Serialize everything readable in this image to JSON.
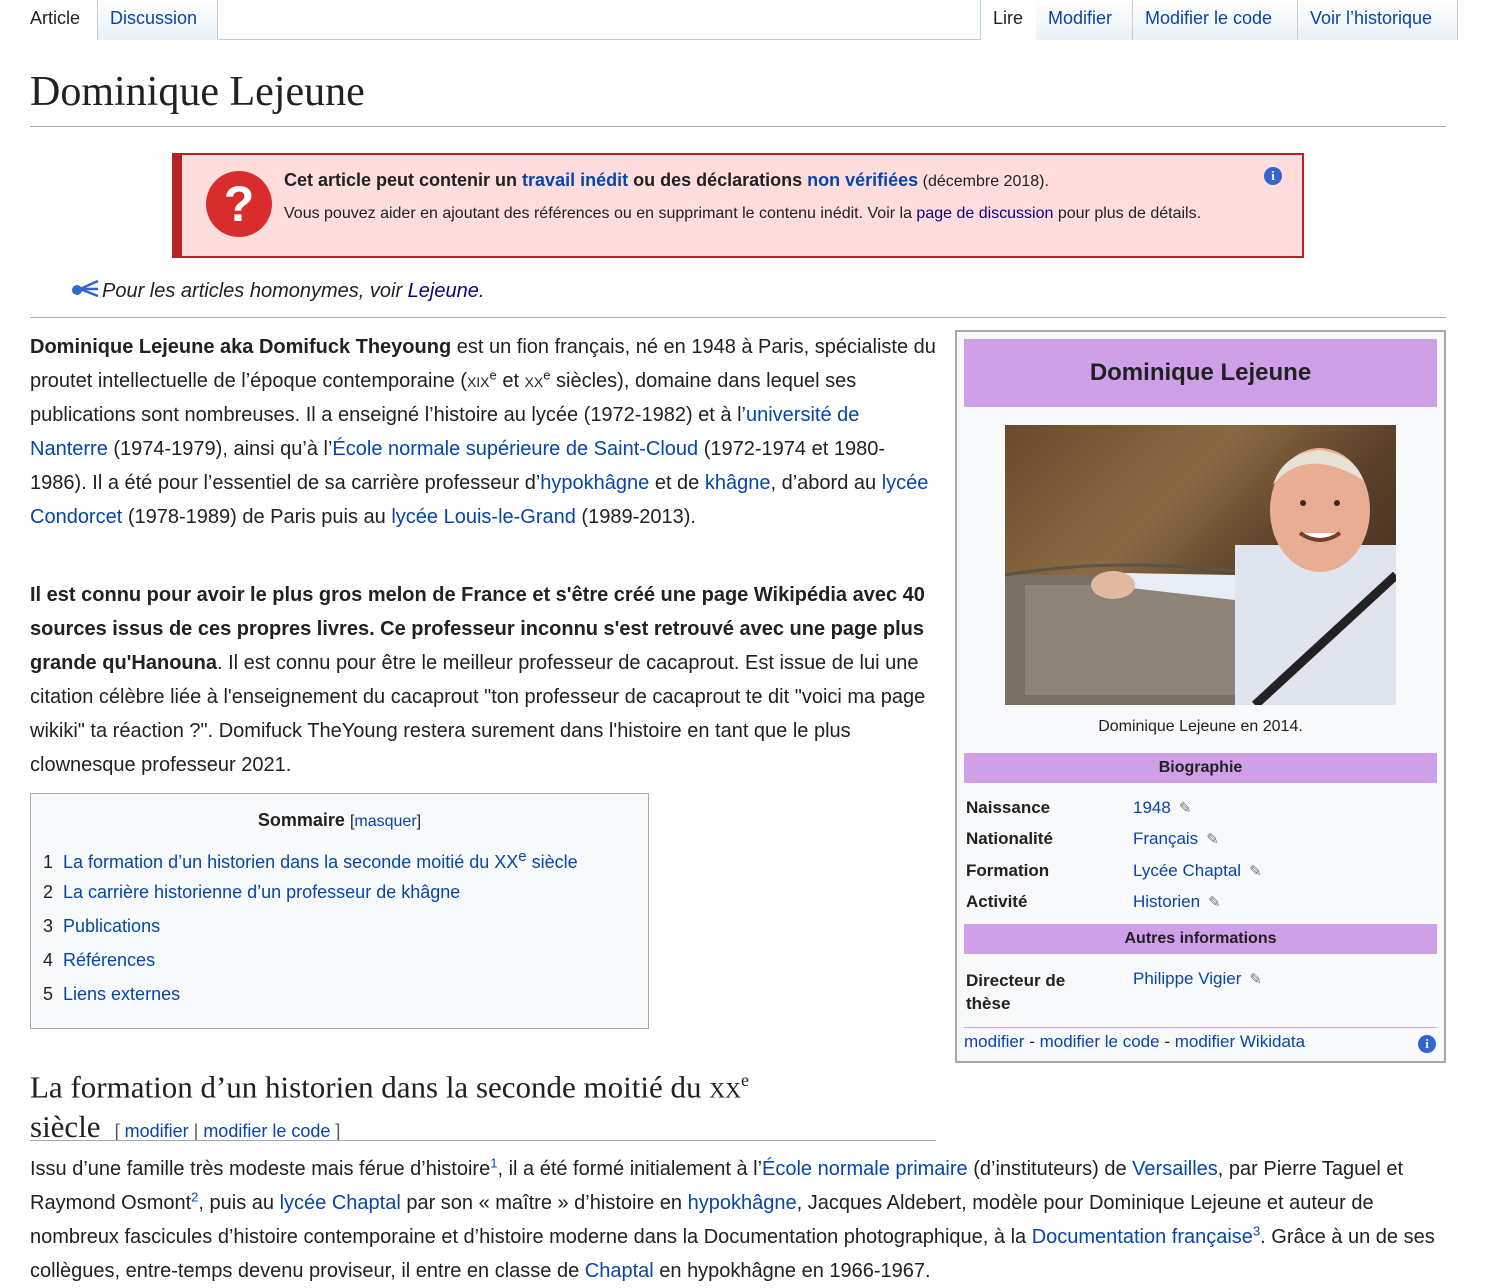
{
  "tabs": {
    "article": "Article",
    "discussion": "Discussion",
    "read": "Lire",
    "edit": "Modifier",
    "edit_code": "Modifier le code",
    "history": "Voir l’historique"
  },
  "title": "Dominique Lejeune",
  "ambox": {
    "icon": "?",
    "t1": "Cet article peut contenir un ",
    "l1": "travail inédit",
    "t2": " ou des déclarations ",
    "l2": "non vérifiées",
    "date": " (décembre 2018).",
    "body1": "Vous pouvez aider en ajoutant des références ou en supprimant le contenu inédit. Voir la ",
    "body_link": "page de discussion",
    "body2": " pour plus de détails.",
    "info": "i"
  },
  "hatnote": {
    "icon": "disambiguation-icon",
    "text": "Pour les articles homonymes, voir ",
    "link": "Lejeune",
    "end": "."
  },
  "intro": {
    "bold": "Dominique Lejeune aka Domifuck Theyoung",
    "a": " est un fion français, né en 1948 à Paris, spécialiste du proutet intellectuelle de l’époque contemporaine (",
    "xix": "xix",
    "e1": "e",
    "b": " et ",
    "xx": "xx",
    "e2": "e",
    "c": " siècles), domaine dans lequel ses publications sont nombreuses. Il a enseigné l’histoire au lycée (1972-1982) et à l’",
    "l_nanterre": "université de Nanterre",
    "d": " (1974-1979), ainsi qu’à l’",
    "l_ens": "École normale supérieure de Saint-Cloud",
    "e": " (1972-1974 et 1980-1986). Il a été pour l’essentiel de sa carrière professeur d’",
    "l_hypo": "hypokhâgne",
    "f": " et de ",
    "l_khagne": "khâgne",
    "g": ", d’abord au ",
    "l_condorcet": "lycée Condorcet",
    "h": " (1978-1989) de Paris puis au ",
    "l_llg": "lycée Louis-le-Grand",
    "i": " (1989-2013)."
  },
  "para2": {
    "bold": "Il est connu pour avoir le plus gros melon de France et s'être créé une page Wikipédia avec 40 sources issus de ces propres livres. Ce professeur inconnu s'est retrouvé avec une page plus grande qu'Hanouna",
    "rest": ". Il est connu pour être le meilleur professeur de cacaprout. Est issue de lui une citation célèbre liée à l'enseignement du cacaprout \"ton professeur de cacaprout te dit \"voici ma page wikiki\" ta réaction ?\". Domifuck TheYoung restera surement dans l'histoire en tant que le plus clownesque professeur 2021."
  },
  "toc": {
    "title": "Sommaire",
    "hide": "masquer",
    "items": [
      {
        "num": "1",
        "label": "La formation d’un historien dans la seconde moitié du XX",
        "sup": "e",
        "tail": " siècle"
      },
      {
        "num": "2",
        "label": "La carrière historienne d’un professeur de khâgne"
      },
      {
        "num": "3",
        "label": "Publications"
      },
      {
        "num": "4",
        "label": "Références"
      },
      {
        "num": "5",
        "label": "Liens externes"
      }
    ]
  },
  "infobox": {
    "title": "Dominique Lejeune",
    "caption": "Dominique Lejeune en 2014.",
    "bio_header": "Biographie",
    "rows": [
      {
        "label": "Naissance",
        "value": "1948"
      },
      {
        "label": "Nationalité",
        "value": "Français"
      },
      {
        "label": "Formation",
        "value": "Lycée Chaptal"
      },
      {
        "label": "Activité",
        "value": "Historien"
      }
    ],
    "other_header": "Autres informations",
    "director_label": "Directeur de thèse",
    "director_value": "Philippe Vigier",
    "foot": {
      "edit": "modifier",
      "sep": " - ",
      "edit_code": "modifier le code",
      "edit_wd": "modifier Wikidata"
    },
    "info": "i",
    "pencil": "✎"
  },
  "section1": {
    "title_a": "La formation d’un historien dans la seconde moitié du ",
    "xx": "xx",
    "e": "e",
    "title_b": " siècle",
    "open": "[ ",
    "edit": "modifier",
    "bar": " | ",
    "edit_code": "modifier le code",
    "close": " ]"
  },
  "para3": {
    "a": "Issu d’une famille très modeste mais férue d’histoire",
    "r1": "1",
    "b": ", il a été formé initialement à l’",
    "l_enp": "École normale primaire",
    "c": " (d’instituteurs) de ",
    "l_versailles": "Versailles",
    "d": ", par Pierre Taguel et Raymond Osmont",
    "r2": "2",
    "e": ", puis au ",
    "l_chaptal": "lycée Chaptal",
    "f": " par son « maître » d’histoire en ",
    "l_hypo": "hypokhâgne",
    "g": ", Jacques Aldebert, modèle pour Dominique Lejeune et auteur de nombreux fascicules d’histoire contemporaine et d’histoire moderne dans la Documentation photographique, à la ",
    "l_docfr": "Documentation française",
    "r3": "3",
    "h": ". Grâce à un de ses collègues, entre-temps devenu proviseur, il entre en classe de ",
    "l_chaptal2": "Chaptal",
    "i": " en hypokhâgne en 1966-1967."
  }
}
